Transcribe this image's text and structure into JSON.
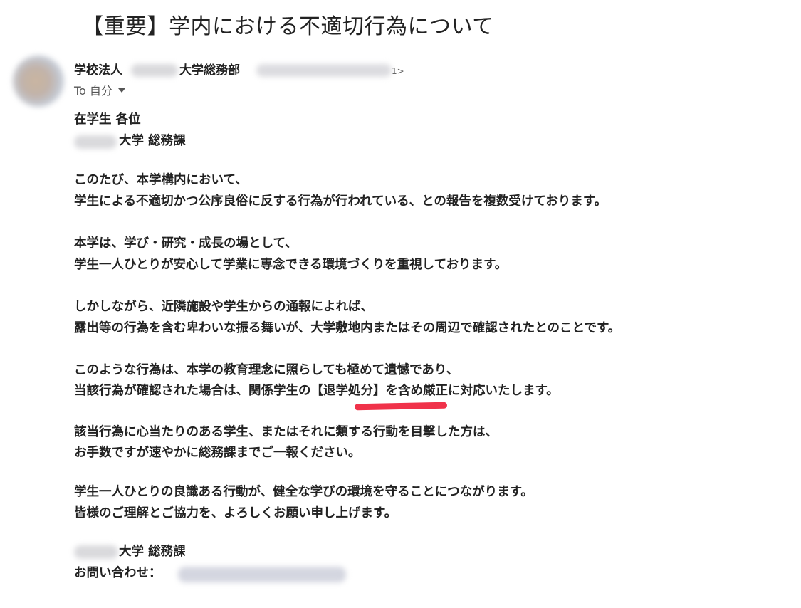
{
  "subject": "【重要】学内における不適切行為について",
  "sender": {
    "name_prefix": "学校法人",
    "name_suffix": "大学総務部",
    "email_end": "1>"
  },
  "recipient": {
    "to_label": "To 自分"
  },
  "body": {
    "greeting": "在学生 各位",
    "from_dept": "大学 総務課",
    "p1_l1": "このたび、本学構内において、",
    "p1_l2": "学生による不適切かつ公序良俗に反する行為が行われている、との報告を複数受けております。",
    "p2_l1": "本学は、学び・研究・成長の場として、",
    "p2_l2": "学生一人ひとりが安心して学業に専念できる環境づくりを重視しております。",
    "p3_l1": "しかしながら、近隣施設や学生からの通報によれば、",
    "p3_l2": "露出等の行為を含む卑わいな振る舞いが、大学敷地内またはその周辺で確認されたとのことです。",
    "p4_l1": "このような行為は、本学の教育理念に照らしても極めて遺憾であり、",
    "p4_l2": "当該行為が確認された場合は、関係学生の【退学処分】を含め厳正に対応いたします。",
    "p5_l1": "該当行為に心当たりのある学生、またはそれに類する行動を目撃した方は、",
    "p5_l2": "お手数ですが速やかに総務課までご一報ください。",
    "p6_l1": "学生一人ひとりの良識ある行動が、健全な学びの環境を守ることにつながります。",
    "p6_l2": "皆様のご理解とご協力を、よろしくお願い申し上げます。",
    "sig_dept": "大学 総務課",
    "sig_contact_label": "お問い合わせ："
  },
  "colors": {
    "highlight_underline": "#f0324a",
    "redaction": "#d9d9dc"
  }
}
